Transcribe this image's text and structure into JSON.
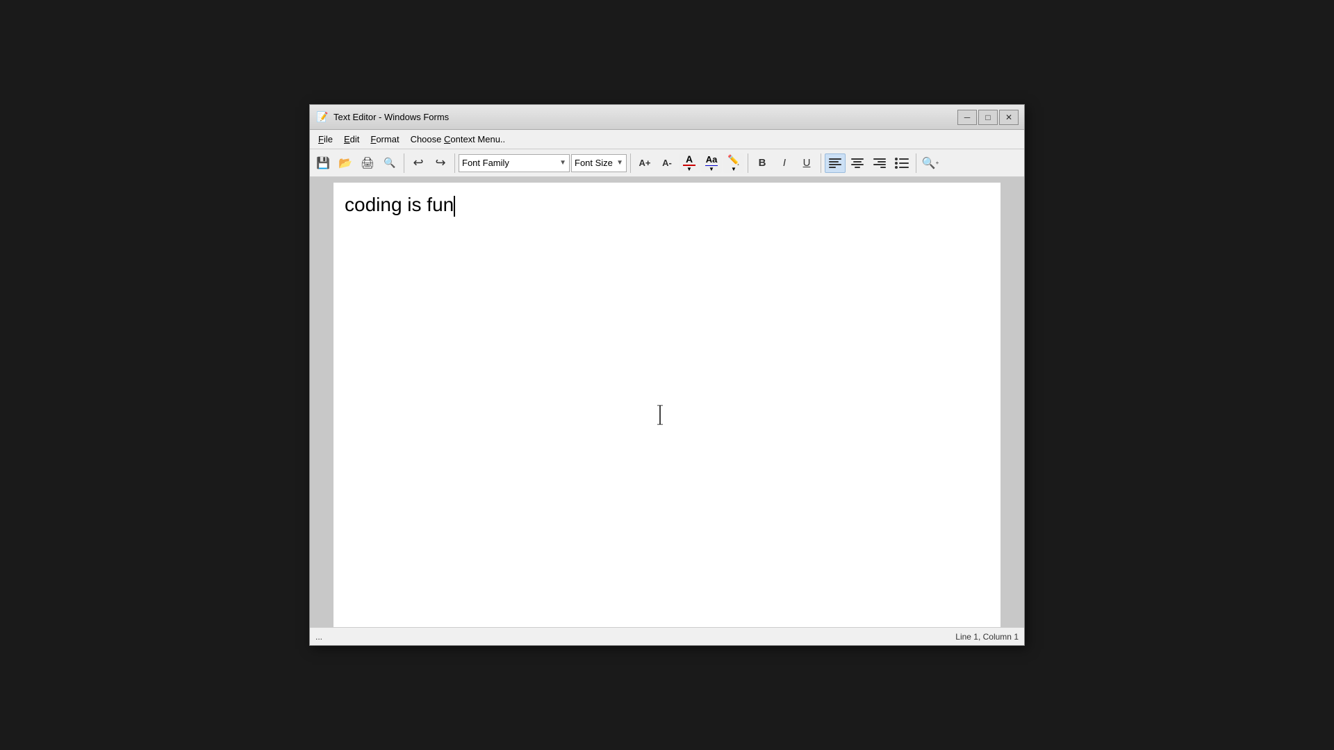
{
  "window": {
    "title": "Text Editor - Windows Forms",
    "icon": "📝"
  },
  "titlebar": {
    "minimize_label": "─",
    "maximize_label": "□",
    "close_label": "✕"
  },
  "menubar": {
    "items": [
      {
        "id": "file",
        "label": "File",
        "underline_index": 0
      },
      {
        "id": "edit",
        "label": "Edit",
        "underline_index": 0
      },
      {
        "id": "format",
        "label": "Format",
        "underline_index": 0
      },
      {
        "id": "context",
        "label": "Choose Context Menu..",
        "underline_index": 7
      }
    ]
  },
  "toolbar": {
    "save_icon": "💾",
    "open_icon": "📂",
    "print_icon": "🖨",
    "print_preview_icon": "🔍",
    "undo_icon": "↩",
    "redo_icon": "↪",
    "font_family_placeholder": "Font Family",
    "font_size_placeholder": "Font Size",
    "font_increase_label": "A+",
    "font_decrease_label": "A-",
    "font_color_label": "A",
    "case_label": "Aa",
    "highlight_symbol": "⬛",
    "bold_label": "B",
    "italic_label": "I",
    "underline_label": "U",
    "align_left_label": "≡",
    "align_center_label": "≡",
    "align_right_label": "≡",
    "bullet_label": "≡",
    "zoom_label": "⊕"
  },
  "editor": {
    "content": "coding is fun",
    "cursor_visible": true,
    "cursor_at_end": true
  },
  "statusbar": {
    "left_text": "...",
    "right_text": "Line 1, Column 1"
  }
}
